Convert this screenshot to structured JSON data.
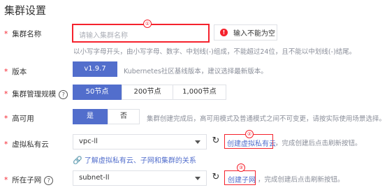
{
  "page": {
    "title": "集群设置"
  },
  "rows": {
    "cluster_name": {
      "label": "集群名称",
      "placeholder": "请输入集群名称",
      "error": "输入不能为空",
      "hint": "以小写字母开头，由小写字母、数字、中划线(-)组成，不能超过24位，且不能以中划线(-)结尾。",
      "callout": "①"
    },
    "version": {
      "label": "版本",
      "value": "v1.9.7",
      "hint": "Kubernetes社区基线版本，建议选择最新版本。"
    },
    "scale": {
      "label": "集群管理规模",
      "options": [
        "50节点",
        "200节点",
        "1,000节点"
      ],
      "selected": "50节点"
    },
    "ha": {
      "label": "高可用",
      "options": [
        "是",
        "否"
      ],
      "selected": "是",
      "hint": "集群创建完成后，高可用模式及普通模式之间不可变更，请按实际使用场景选择。"
    },
    "vpc": {
      "label": "虚拟私有云",
      "value": "vpc-ll",
      "create_link": "创建虚拟私有云",
      "after_link": "，完成创建后点击刷新按钮。",
      "relation_link": "了解虚拟私有云、子网和集群的关系",
      "callout": "②"
    },
    "subnet": {
      "label": "所在子网",
      "value": "subnet-ll",
      "create_link": "创建子网",
      "after_link": "，完成创建后点击刷新按钮。",
      "callout": "③"
    }
  },
  "icons": {
    "required": "*",
    "help": "?",
    "error": "!",
    "refresh": "↻",
    "link": "🔗"
  },
  "colors": {
    "primary": "#526ecc",
    "error": "#f5222d",
    "text": "#333333",
    "hint": "#8a8e99"
  }
}
